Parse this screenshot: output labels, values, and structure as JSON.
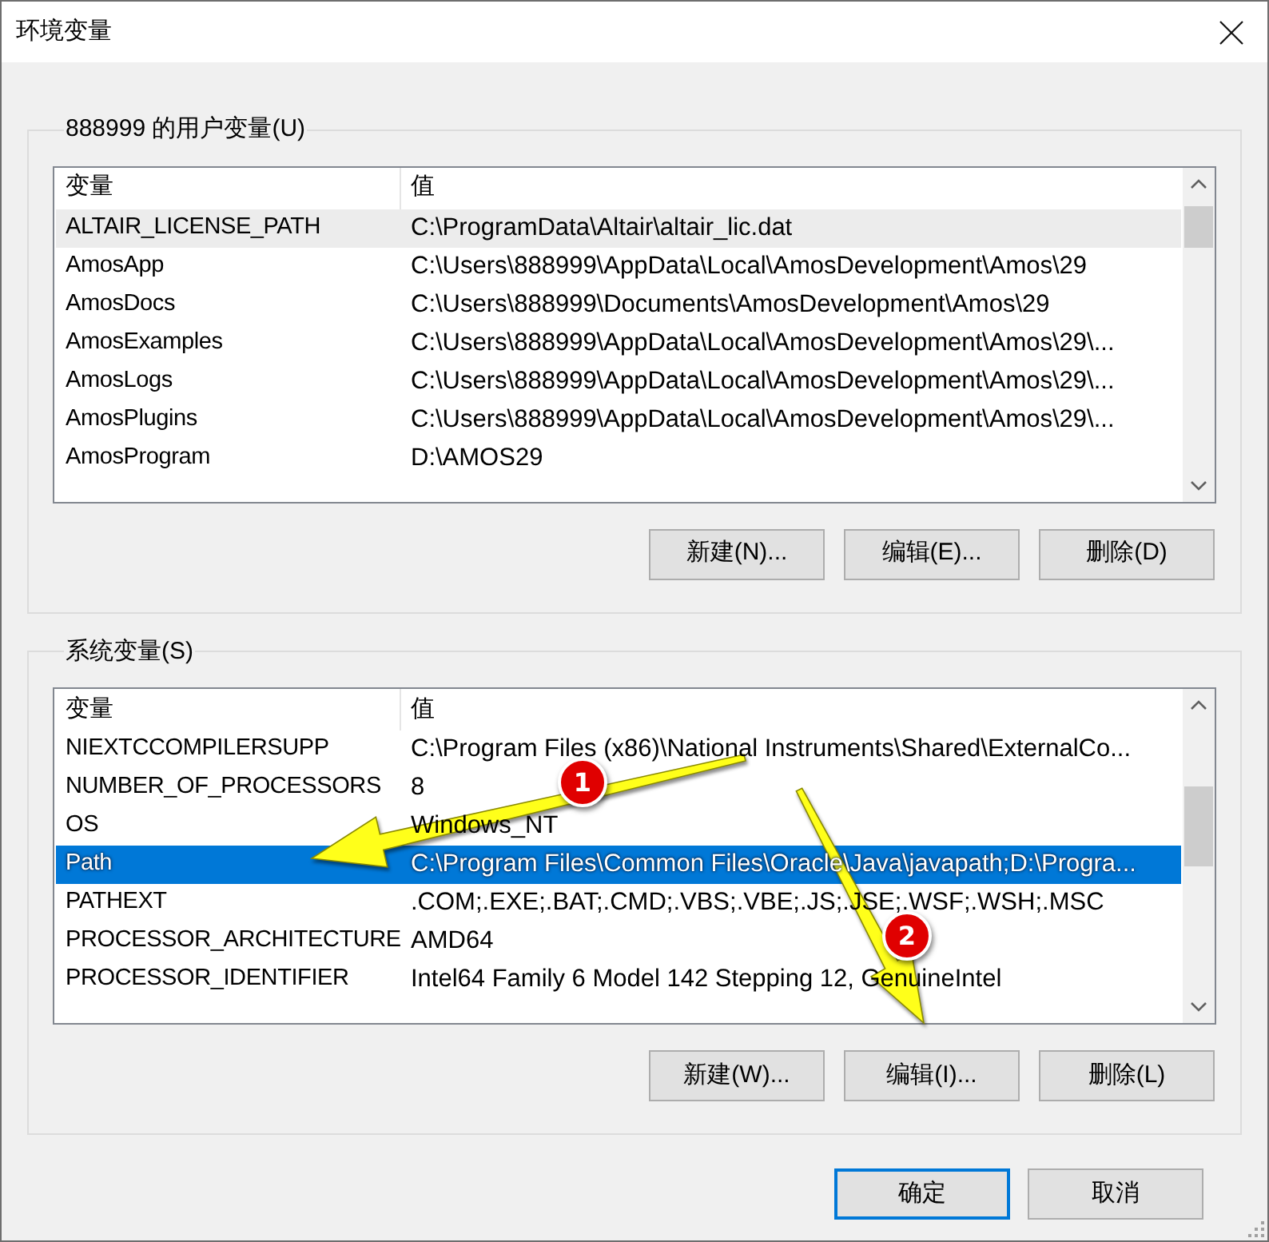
{
  "window": {
    "title": "环境变量"
  },
  "user_variables": {
    "title": "888999 的用户变量(U)",
    "focused": false,
    "columns": [
      "变量",
      "值"
    ],
    "rows": [
      {
        "name": "ALTAIR_LICENSE_PATH",
        "value": "C:\\ProgramData\\Altair\\altair_lic.dat",
        "selected": true
      },
      {
        "name": "AmosApp",
        "value": "C:\\Users\\888999\\AppData\\Local\\AmosDevelopment\\Amos\\29",
        "selected": false
      },
      {
        "name": "AmosDocs",
        "value": "C:\\Users\\888999\\Documents\\AmosDevelopment\\Amos\\29",
        "selected": false
      },
      {
        "name": "AmosExamples",
        "value": "C:\\Users\\888999\\AppData\\Local\\AmosDevelopment\\Amos\\29\\...",
        "selected": false
      },
      {
        "name": "AmosLogs",
        "value": "C:\\Users\\888999\\AppData\\Local\\AmosDevelopment\\Amos\\29\\...",
        "selected": false
      },
      {
        "name": "AmosPlugins",
        "value": "C:\\Users\\888999\\AppData\\Local\\AmosDevelopment\\Amos\\29\\...",
        "selected": false
      },
      {
        "name": "AmosProgram",
        "value": "D:\\AMOS29",
        "selected": false
      }
    ],
    "buttons": [
      "新建(N)...",
      "编辑(E)...",
      "删除(D)"
    ]
  },
  "system_variables": {
    "title": "系统变量(S)",
    "focused": true,
    "columns": [
      "变量",
      "值"
    ],
    "rows": [
      {
        "name": "NIEXTCCOMPILERSUPP",
        "value": "C:\\Program Files (x86)\\National Instruments\\Shared\\ExternalCo...",
        "selected": false
      },
      {
        "name": "NUMBER_OF_PROCESSORS",
        "value": "8",
        "selected": false
      },
      {
        "name": "OS",
        "value": "Windows_NT",
        "selected": false
      },
      {
        "name": "Path",
        "value": "C:\\Program Files\\Common Files\\Oracle\\Java\\javapath;D:\\Progra...",
        "selected": true
      },
      {
        "name": "PATHEXT",
        "value": ".COM;.EXE;.BAT;.CMD;.VBS;.VBE;.JS;.JSE;.WSF;.WSH;.MSC",
        "selected": false
      },
      {
        "name": "PROCESSOR_ARCHITECTURE",
        "value": "AMD64",
        "selected": false
      },
      {
        "name": "PROCESSOR_IDENTIFIER",
        "value": "Intel64 Family 6 Model 142 Stepping 12, GenuineIntel",
        "selected": false
      }
    ],
    "buttons": [
      "新建(W)...",
      "编辑(I)...",
      "删除(L)"
    ]
  },
  "dialog_buttons": [
    {
      "label": "确定",
      "default": true
    },
    {
      "label": "取消",
      "default": false
    }
  ],
  "annotations": [
    {
      "number": "1"
    },
    {
      "number": "2"
    }
  ]
}
